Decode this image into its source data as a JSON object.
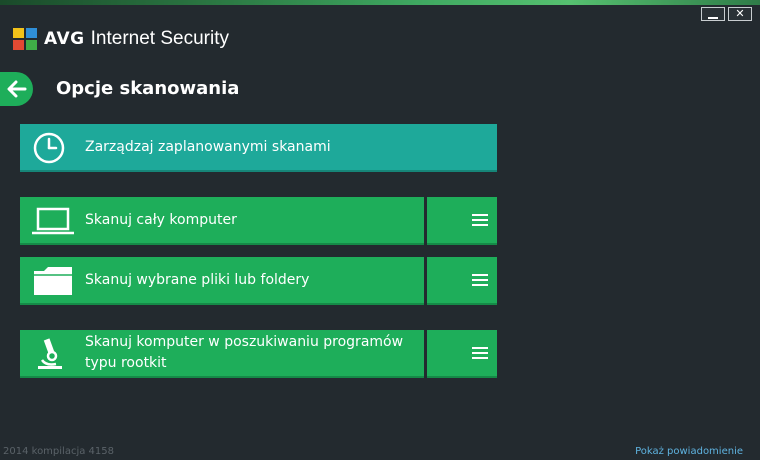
{
  "window": {
    "minimize_icon": "minimize-icon",
    "close_symbol": "✕"
  },
  "brand": {
    "logo_text": "AVG",
    "product": "Internet Security"
  },
  "header": {
    "back_icon": "arrow-left-icon",
    "title": "Opcje skanowania"
  },
  "scan_options": [
    {
      "label": "Zarządzaj zaplanowanymi skanami",
      "icon": "clock-icon",
      "color": "#1ea99a"
    },
    {
      "label": "Skanuj cały komputer",
      "icon": "laptop-icon",
      "color": "#1eae5a",
      "menu_icon": "hamburger-menu-icon"
    },
    {
      "label": "Skanuj wybrane pliki lub foldery",
      "icon": "folder-icon",
      "color": "#1eae5a",
      "menu_icon": "hamburger-menu-icon"
    },
    {
      "label": "Skanuj komputer w poszukiwaniu programów\ntypu rootkit",
      "icon": "microscope-icon",
      "color": "#1eae5a",
      "menu_icon": "hamburger-menu-icon"
    }
  ],
  "footer": {
    "version": "2014  kompilacja 4158",
    "link": "Pokaż powiadomienie"
  },
  "colors": {
    "background": "#232a2f",
    "accent_green": "#1eae5a",
    "accent_teal": "#1ea99a",
    "link": "#5fb3e0"
  }
}
